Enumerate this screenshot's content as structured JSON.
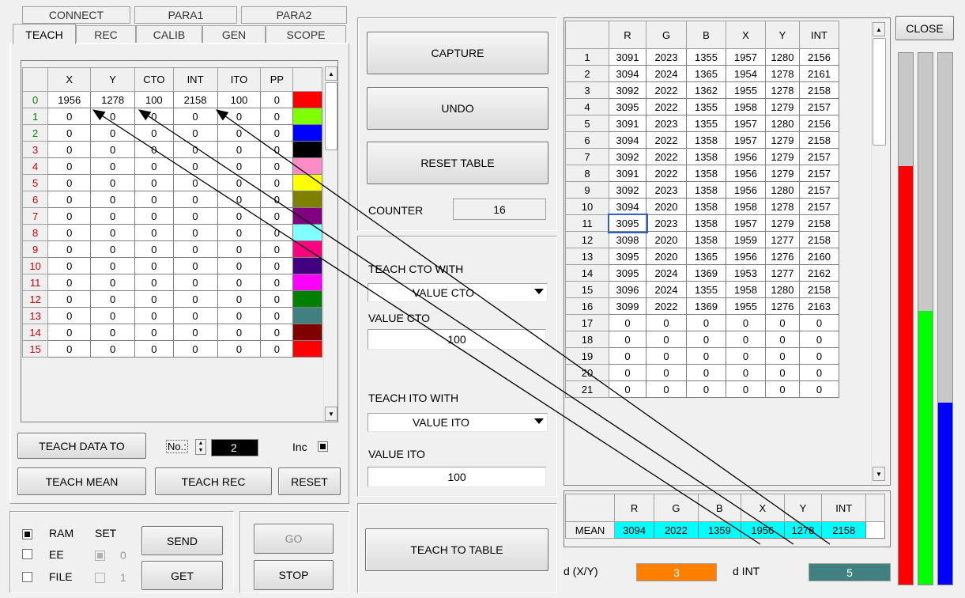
{
  "tabs_row1": [
    "CONNECT",
    "PARA1",
    "PARA2"
  ],
  "tabs_row2": [
    "TEACH",
    "REC",
    "CALIB",
    "GEN",
    "SCOPE"
  ],
  "teach_table": {
    "columns": [
      "X",
      "Y",
      "CTO",
      "INT",
      "ITO",
      "PP"
    ],
    "rows": [
      {
        "idx": "0",
        "vals": [
          "1956",
          "1278",
          "100",
          "2158",
          "100",
          "0"
        ],
        "color": "#ff0000"
      },
      {
        "idx": "1",
        "vals": [
          "0",
          "0",
          "0",
          "0",
          "0",
          "0"
        ],
        "color": "#80ff00"
      },
      {
        "idx": "2",
        "vals": [
          "0",
          "0",
          "0",
          "0",
          "0",
          "0"
        ],
        "color": "#0000ff"
      },
      {
        "idx": "3",
        "vals": [
          "0",
          "0",
          "0",
          "0",
          "0",
          "0"
        ],
        "color": "#000000"
      },
      {
        "idx": "4",
        "vals": [
          "0",
          "0",
          "0",
          "0",
          "0",
          "0"
        ],
        "color": "#ff8cc8"
      },
      {
        "idx": "5",
        "vals": [
          "0",
          "0",
          "0",
          "0",
          "0",
          "0"
        ],
        "color": "#ffff00"
      },
      {
        "idx": "6",
        "vals": [
          "0",
          "0",
          "0",
          "0",
          "0",
          "0"
        ],
        "color": "#808000"
      },
      {
        "idx": "7",
        "vals": [
          "0",
          "0",
          "0",
          "0",
          "0",
          "0"
        ],
        "color": "#800080"
      },
      {
        "idx": "8",
        "vals": [
          "0",
          "0",
          "0",
          "0",
          "0",
          "0"
        ],
        "color": "#80ffff"
      },
      {
        "idx": "9",
        "vals": [
          "0",
          "0",
          "0",
          "0",
          "0",
          "0"
        ],
        "color": "#ff0080"
      },
      {
        "idx": "10",
        "vals": [
          "0",
          "0",
          "0",
          "0",
          "0",
          "0"
        ],
        "color": "#400080"
      },
      {
        "idx": "11",
        "vals": [
          "0",
          "0",
          "0",
          "0",
          "0",
          "0"
        ],
        "color": "#ff00ff"
      },
      {
        "idx": "12",
        "vals": [
          "0",
          "0",
          "0",
          "0",
          "0",
          "0"
        ],
        "color": "#008000"
      },
      {
        "idx": "13",
        "vals": [
          "0",
          "0",
          "0",
          "0",
          "0",
          "0"
        ],
        "color": "#408080"
      },
      {
        "idx": "14",
        "vals": [
          "0",
          "0",
          "0",
          "0",
          "0",
          "0"
        ],
        "color": "#800000"
      },
      {
        "idx": "15",
        "vals": [
          "0",
          "0",
          "0",
          "0",
          "0",
          "0"
        ],
        "color": "#ff0000"
      }
    ]
  },
  "left_buttons": {
    "teach_data_to": "TEACH DATA TO",
    "no_label": "No.:",
    "no_value": "2",
    "inc_label": "Inc",
    "teach_mean": "TEACH MEAN",
    "teach_rec": "TEACH REC",
    "reset": "RESET"
  },
  "memory": {
    "ram": "RAM",
    "ee": "EE",
    "file": "FILE",
    "set": "SET",
    "set0": "0",
    "set1": "1",
    "send": "SEND",
    "get": "GET",
    "go": "GO",
    "stop": "STOP"
  },
  "middle": {
    "capture": "CAPTURE",
    "undo": "UNDO",
    "reset_table": "RESET TABLE",
    "counter_label": "COUNTER",
    "counter_value": "16",
    "teach_cto_with": "TEACH CTO WITH",
    "cto_select": "VALUE CTO",
    "value_cto_label": "VALUE CTO",
    "value_cto": "100",
    "teach_ito_with": "TEACH ITO WITH",
    "ito_select": "VALUE ITO",
    "value_ito_label": "VALUE ITO",
    "value_ito": "100",
    "teach_to_table": "TEACH TO TABLE"
  },
  "data_table": {
    "columns": [
      "R",
      "G",
      "B",
      "X",
      "Y",
      "INT"
    ],
    "rows": [
      {
        "idx": "1",
        "vals": [
          "3091",
          "2023",
          "1355",
          "1957",
          "1280",
          "2156"
        ]
      },
      {
        "idx": "2",
        "vals": [
          "3094",
          "2024",
          "1365",
          "1954",
          "1278",
          "2161"
        ]
      },
      {
        "idx": "3",
        "vals": [
          "3092",
          "2022",
          "1362",
          "1955",
          "1278",
          "2158"
        ]
      },
      {
        "idx": "4",
        "vals": [
          "3095",
          "2022",
          "1355",
          "1958",
          "1279",
          "2157"
        ]
      },
      {
        "idx": "5",
        "vals": [
          "3091",
          "2023",
          "1355",
          "1957",
          "1280",
          "2156"
        ]
      },
      {
        "idx": "6",
        "vals": [
          "3094",
          "2022",
          "1358",
          "1957",
          "1279",
          "2158"
        ]
      },
      {
        "idx": "7",
        "vals": [
          "3092",
          "2022",
          "1358",
          "1956",
          "1279",
          "2157"
        ]
      },
      {
        "idx": "8",
        "vals": [
          "3091",
          "2022",
          "1358",
          "1956",
          "1279",
          "2157"
        ]
      },
      {
        "idx": "9",
        "vals": [
          "3092",
          "2023",
          "1358",
          "1956",
          "1280",
          "2157"
        ]
      },
      {
        "idx": "10",
        "vals": [
          "3094",
          "2020",
          "1358",
          "1958",
          "1278",
          "2157"
        ]
      },
      {
        "idx": "11",
        "vals": [
          "3095",
          "2023",
          "1358",
          "1957",
          "1279",
          "2158"
        ]
      },
      {
        "idx": "12",
        "vals": [
          "3098",
          "2020",
          "1358",
          "1959",
          "1277",
          "2158"
        ]
      },
      {
        "idx": "13",
        "vals": [
          "3095",
          "2020",
          "1365",
          "1956",
          "1276",
          "2160"
        ]
      },
      {
        "idx": "14",
        "vals": [
          "3095",
          "2024",
          "1369",
          "1953",
          "1277",
          "2162"
        ]
      },
      {
        "idx": "15",
        "vals": [
          "3096",
          "2024",
          "1355",
          "1958",
          "1280",
          "2158"
        ]
      },
      {
        "idx": "16",
        "vals": [
          "3099",
          "2022",
          "1369",
          "1955",
          "1276",
          "2163"
        ]
      },
      {
        "idx": "17",
        "vals": [
          "0",
          "0",
          "0",
          "0",
          "0",
          "0"
        ]
      },
      {
        "idx": "18",
        "vals": [
          "0",
          "0",
          "0",
          "0",
          "0",
          "0"
        ]
      },
      {
        "idx": "19",
        "vals": [
          "0",
          "0",
          "0",
          "0",
          "0",
          "0"
        ]
      },
      {
        "idx": "20",
        "vals": [
          "0",
          "0",
          "0",
          "0",
          "0",
          "0"
        ]
      },
      {
        "idx": "21",
        "vals": [
          "0",
          "0",
          "0",
          "0",
          "0",
          "0"
        ]
      }
    ]
  },
  "mean_table": {
    "label": "MEAN",
    "columns": [
      "R",
      "G",
      "B",
      "X",
      "Y",
      "INT"
    ],
    "vals": [
      "3094",
      "2022",
      "1359",
      "1956",
      "1278",
      "2158"
    ]
  },
  "deltas": {
    "dxy_label": "d (X/Y)",
    "dxy_value": "3",
    "dint_label": "d INT",
    "dint_value": "5"
  },
  "close": "CLOSE",
  "rgb_bars": {
    "red_level": 0.787,
    "green_level": 0.515,
    "blue_level": 0.342,
    "colors": [
      "#ff0000",
      "#00ff00",
      "#0000ff"
    ]
  }
}
